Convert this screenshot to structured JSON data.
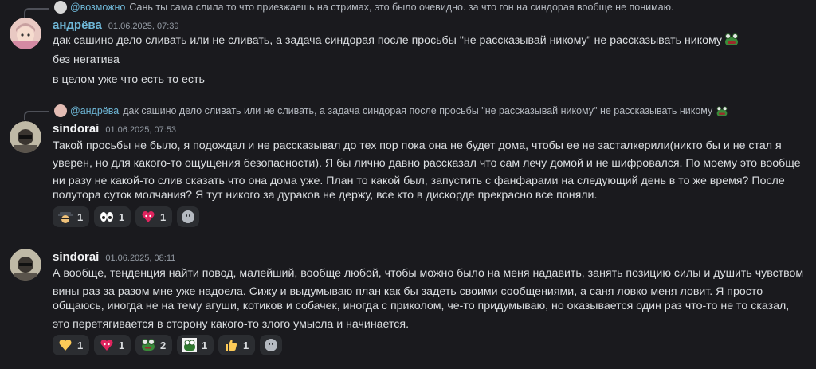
{
  "messages": [
    {
      "reply": {
        "mention": "@возможно",
        "text": "Сань ты сама слила то что приезжаешь на стримах, это было очевидно. за что гон на синдорая вообще не понимаю."
      },
      "author": "андрёва",
      "author_color": "#6fb8d8",
      "timestamp": "01.06.2025, 07:39",
      "lines": [
        "дак сашино дело сливать или не сливать, а задача синдорая после просьбы \"не рассказывай никому\" не рассказывать никому",
        "без негатива",
        "в целом уже что есть то есть"
      ]
    },
    {
      "reply": {
        "mention": "@андрёва",
        "text": "дак сашино дело сливать или не сливать, а задача синдорая после просьбы \"не рассказывай никому\" не рассказывать никому"
      },
      "author": "sindorai",
      "author_color": "#f2f3f5",
      "timestamp": "01.06.2025, 07:53",
      "lines": [
        "Такой просьбы не было, я подождал и не рассказывал до тех пор пока она не будет дома, чтобы ее не засталкерили(никто бы и не стал я",
        "уверен, но для какого-то ощущения безопасности). Я бы лично давно рассказал что сам лечу домой и не шифровался. По моему это вообще",
        "ни разу не какой-то слив сказать что она дома уже. План то какой был, запустить с фанфарами на следующий день в то же время? После",
        "полутора суток молчания? Я тут никого за дураков не держу, все кто в дискорде прекрасно все поняли."
      ],
      "reactions": [
        {
          "emoji": "spy-emoji",
          "count": "1"
        },
        {
          "emoji": "eyes-emoji",
          "count": "1"
        },
        {
          "emoji": "heart-face-emoji",
          "count": "1"
        }
      ]
    },
    {
      "author": "sindorai",
      "author_color": "#f2f3f5",
      "timestamp": "01.06.2025, 08:11",
      "lines": [
        "А вообще, тенденция найти повод, малейший, вообще любой, чтобы можно было на меня надавить, занять позицию силы и душить чувством",
        "вины раз за разом мне уже надоела. Сижу и выдумываю план как бы задеть своими сообщениями, а саня ловко меня ловит. Я просто",
        "общаюсь, иногда не на тему агуши, котиков и собачек, иногда с приколом, че-то придумываю, но оказывается один раз что-то не то сказал,",
        "это перетягивается в сторону какого-то злого умысла и начинается."
      ],
      "reactions": [
        {
          "emoji": "yellow-heart-emoji",
          "count": "1"
        },
        {
          "emoji": "heart-face-emoji",
          "count": "1"
        },
        {
          "emoji": "frog-emoji",
          "count": "2"
        },
        {
          "emoji": "frog-box-emoji",
          "count": "1"
        },
        {
          "emoji": "thumbs-up-emoji",
          "count": "1"
        }
      ]
    }
  ]
}
